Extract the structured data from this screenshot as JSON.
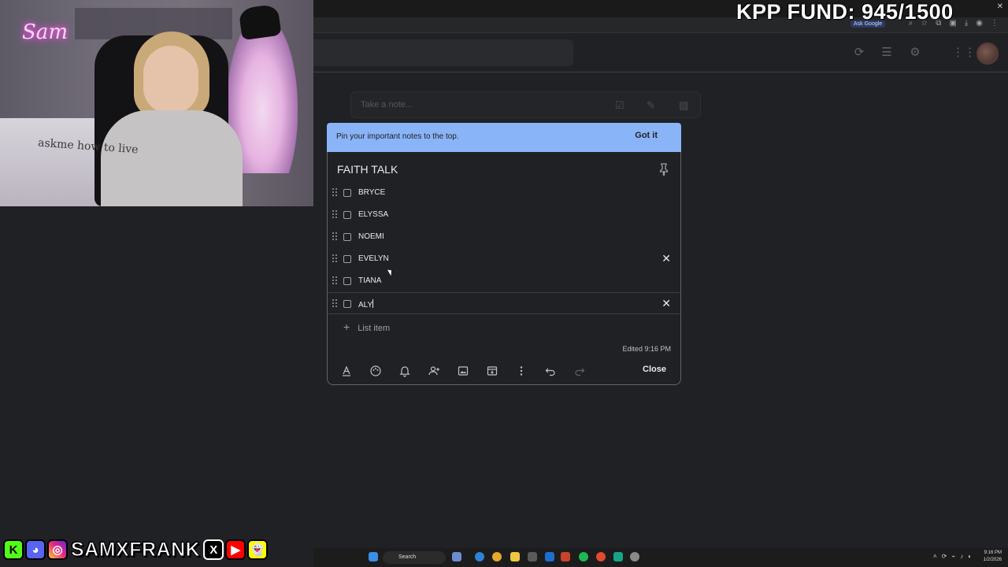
{
  "overlay": {
    "fund_text": "KPP FUND: 945/1500",
    "social_handle": "SAMXFRANK",
    "neon_sign": "Sam",
    "sweater_print": "askme how to live",
    "social_icons": [
      "kick-icon",
      "discord-icon",
      "instagram-icon",
      "x-icon",
      "youtube-icon",
      "snapchat-icon"
    ]
  },
  "browser": {
    "ask_google": "Ask Google"
  },
  "keep": {
    "take_note_placeholder": "Take a note...",
    "toast": {
      "message": "Pin your important notes to the top.",
      "action": "Got it",
      "color": "#8ab4f8"
    },
    "note": {
      "title": "FAITH TALK",
      "items": [
        {
          "label": "BRYCE",
          "checked": false,
          "show_delete": false
        },
        {
          "label": "ELYSSA",
          "checked": false,
          "show_delete": false
        },
        {
          "label": "NOEMI",
          "checked": false,
          "show_delete": false
        },
        {
          "label": "EVELYN",
          "checked": false,
          "show_delete": true
        },
        {
          "label": "TIANA",
          "checked": false,
          "show_delete": false
        },
        {
          "label": "ALY",
          "checked": false,
          "show_delete": true
        }
      ],
      "add_item_placeholder": "List item",
      "edited": "Edited 9:16 PM",
      "close_label": "Close",
      "toolbar_icons": [
        "text-format-icon",
        "palette-icon",
        "reminder-bell-icon",
        "collaborator-icon",
        "image-icon",
        "archive-icon",
        "more-icon",
        "undo-icon",
        "redo-icon"
      ]
    }
  },
  "taskbar": {
    "search_label": "Search",
    "time": "9:16 PM",
    "date": "1/2/2026"
  }
}
